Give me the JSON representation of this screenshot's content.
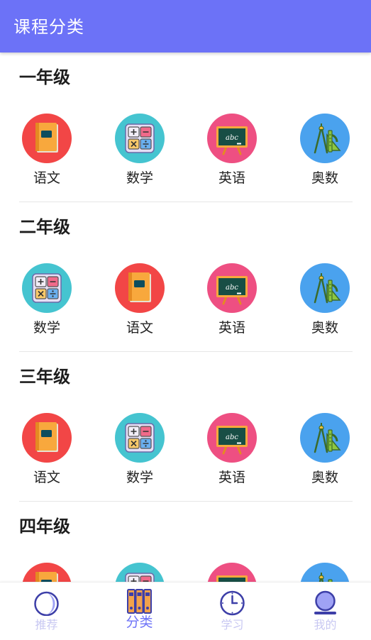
{
  "app_bar": {
    "title": "课程分类"
  },
  "sections": [
    {
      "title": "一年级",
      "courses": [
        {
          "label": "语文",
          "icon": "book-icon"
        },
        {
          "label": "数学",
          "icon": "calculator-icon"
        },
        {
          "label": "英语",
          "icon": "blackboard-icon"
        },
        {
          "label": "奥数",
          "icon": "compass-icon"
        }
      ]
    },
    {
      "title": "二年级",
      "courses": [
        {
          "label": "数学",
          "icon": "calculator-icon"
        },
        {
          "label": "语文",
          "icon": "book-icon"
        },
        {
          "label": "英语",
          "icon": "blackboard-icon"
        },
        {
          "label": "奥数",
          "icon": "compass-icon"
        }
      ]
    },
    {
      "title": "三年级",
      "courses": [
        {
          "label": "语文",
          "icon": "book-icon"
        },
        {
          "label": "数学",
          "icon": "calculator-icon"
        },
        {
          "label": "英语",
          "icon": "blackboard-icon"
        },
        {
          "label": "奥数",
          "icon": "compass-icon"
        }
      ]
    },
    {
      "title": "四年级",
      "courses": [
        {
          "label": "",
          "icon": "book-icon"
        },
        {
          "label": "",
          "icon": "calculator-icon"
        },
        {
          "label": "",
          "icon": "blackboard-icon"
        },
        {
          "label": "",
          "icon": "compass-icon"
        }
      ]
    }
  ],
  "icon_colors": {
    "book-icon": "#f24646",
    "calculator-icon": "#45c4d0",
    "blackboard-icon": "#ee4f82",
    "compass-icon": "#4aa2ee"
  },
  "bottom_nav": [
    {
      "label": "推荐",
      "icon": "moon-icon",
      "active": false
    },
    {
      "label": "分类",
      "icon": "bookshelf-icon",
      "active": true
    },
    {
      "label": "学习",
      "icon": "clock-icon",
      "active": false
    },
    {
      "label": "我的",
      "icon": "profile-icon",
      "active": false
    }
  ],
  "colors": {
    "primary": "#6c72f7",
    "nav_inactive": "#c8c8f2"
  }
}
